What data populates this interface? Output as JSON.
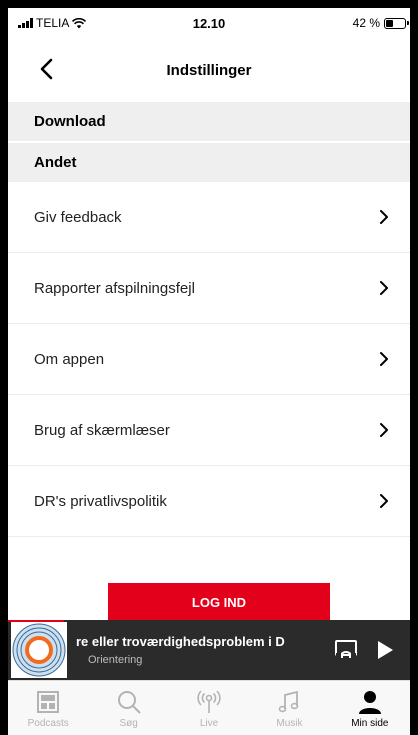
{
  "status_bar": {
    "carrier": "TELIA",
    "time": "12.10",
    "battery_text": "42 %",
    "battery_level": 0.42
  },
  "header": {
    "title": "Indstillinger",
    "back_icon": "chevron-left-icon"
  },
  "sections": [
    {
      "label": "Download"
    },
    {
      "label": "Andet"
    }
  ],
  "menu_items": [
    {
      "label": "Giv feedback"
    },
    {
      "label": "Rapporter afspilningsfejl"
    },
    {
      "label": "Om appen"
    },
    {
      "label": "Brug af skærmlæser"
    },
    {
      "label": "DR's privatlivspolitik"
    }
  ],
  "login_button": "LOG IND",
  "player": {
    "title": "re eller troværdighedsproblem i D",
    "subtitle": "Orientering",
    "progress": 0.14,
    "accent_color": "#e3001b"
  },
  "tabs": [
    {
      "label": "Podcasts",
      "icon": "podcasts-icon",
      "active": false
    },
    {
      "label": "Søg",
      "icon": "search-icon",
      "active": false
    },
    {
      "label": "Live",
      "icon": "live-radio-icon",
      "active": false
    },
    {
      "label": "Musik",
      "icon": "music-note-icon",
      "active": false
    },
    {
      "label": "Min side",
      "icon": "user-icon",
      "active": true
    }
  ]
}
